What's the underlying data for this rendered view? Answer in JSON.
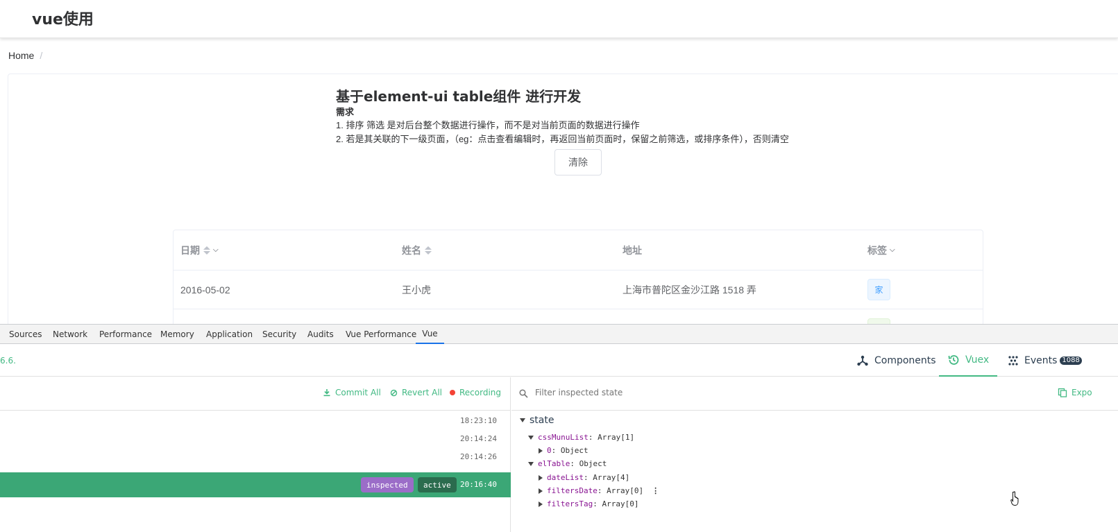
{
  "app": {
    "title": "vue使用",
    "breadcrumb": [
      "Home",
      "/"
    ]
  },
  "intro": {
    "heading": "基于element-ui table组件 进行开发",
    "requirement_label": "需求",
    "line1": "1. 排序 筛选 是对后台整个数据进行操作，而不是对当前页面的数据进行操作",
    "line2": "2. 若是其关联的下一级页面，（eg：点击查看编辑时，再返回当前页面时，保留之前筛选，或排序条件），否则清空",
    "clear_button": "清除"
  },
  "table": {
    "columns": [
      "日期",
      "姓名",
      "地址",
      "标签"
    ],
    "rows": [
      {
        "date": "2016-05-02",
        "name": "王小虎",
        "address": "上海市普陀区金沙江路 1518 弄",
        "tag": "家"
      }
    ]
  },
  "devtools": {
    "tabs": [
      "Sources",
      "Network",
      "Performance",
      "Memory",
      "Application",
      "Security",
      "Audits",
      "Vue Performance",
      "Vue"
    ],
    "active_tab": "Vue",
    "version": "6.6.",
    "vue_tabs": {
      "components": "Components",
      "vuex": "Vuex",
      "events": "Events",
      "events_count": "1088"
    },
    "toolbar": {
      "commit_all": "Commit All",
      "revert_all": "Revert All",
      "recording": "Recording"
    },
    "history": [
      {
        "time": "18:23:10"
      },
      {
        "time": "20:14:24"
      },
      {
        "time": "20:14:26"
      },
      {
        "time": "20:16:40",
        "inspected": "inspected",
        "active": "active"
      }
    ],
    "filter_placeholder": "Filter inspected state",
    "export_label": "Expo",
    "state": {
      "root": "state",
      "rows": [
        {
          "key": "cssMunuList",
          "value": "Array[1]"
        },
        {
          "key": "0",
          "value": "Object"
        },
        {
          "key": "elTable",
          "value": "Object"
        },
        {
          "key": "dateList",
          "value": "Array[4]"
        },
        {
          "key": "filtersDate",
          "value": "Array[0]"
        },
        {
          "key": "filtersTag",
          "value": "Array[0]"
        }
      ]
    }
  },
  "colors": {
    "vue_green": "#42b983",
    "selected_row": "#3ba776",
    "inspected_pill": "#9b6dc8",
    "active_pill": "#2b6c4e",
    "recording_dot": "#f44336"
  }
}
